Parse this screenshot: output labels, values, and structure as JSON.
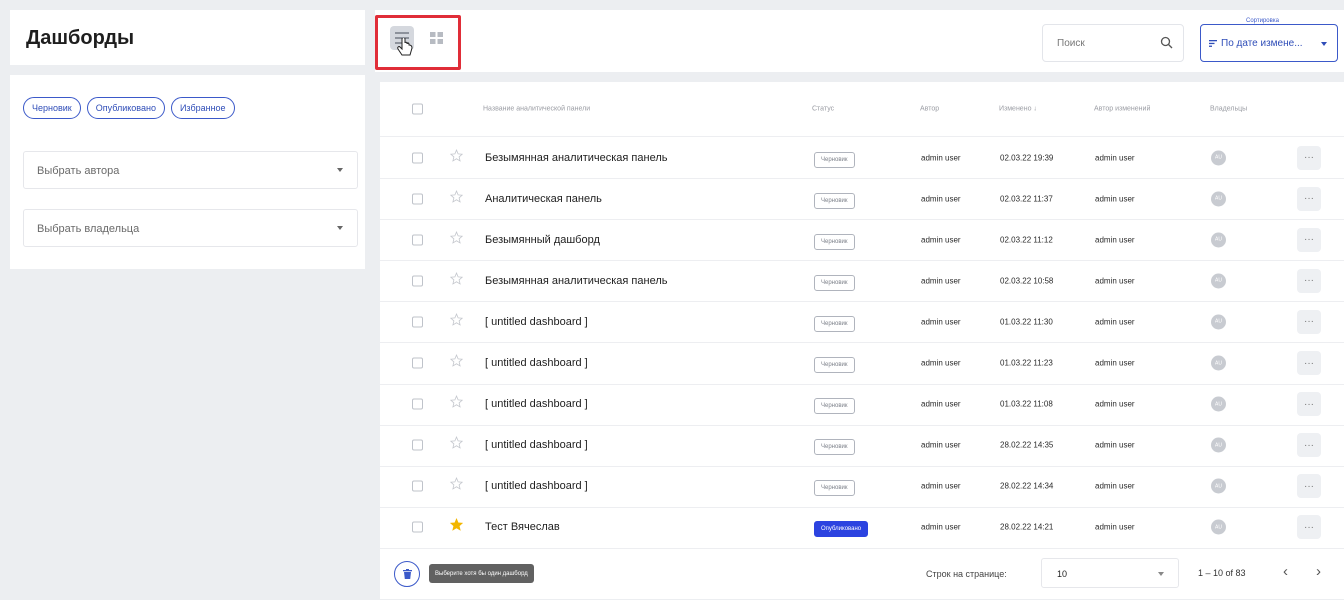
{
  "page": {
    "title": "Дашборды"
  },
  "filters": {
    "chips": [
      "Черновик",
      "Опубликовано",
      "Избранное"
    ],
    "author_select": "Выбрать автора",
    "owner_select": "Выбрать владельца"
  },
  "toolbar": {
    "search_placeholder": "Поиск",
    "sort_legend": "Сортировка",
    "sort_value": "По дате измене..."
  },
  "table": {
    "columns": {
      "name": "Название аналитической панели",
      "status": "Статус",
      "author": "Автор",
      "modified": "Изменено ↓",
      "modified_by": "Автор изменений",
      "owners": "Владельцы"
    },
    "rows": [
      {
        "name": "Безымянная аналитическая панель",
        "status": "Черновик",
        "published": false,
        "favorite": false,
        "author": "admin user",
        "modified": "02.03.22 19:39",
        "modified_by": "admin user",
        "owner": "AU"
      },
      {
        "name": "Аналитическая панель",
        "status": "Черновик",
        "published": false,
        "favorite": false,
        "author": "admin user",
        "modified": "02.03.22 11:37",
        "modified_by": "admin user",
        "owner": "AU"
      },
      {
        "name": "Безымянный дашборд",
        "status": "Черновик",
        "published": false,
        "favorite": false,
        "author": "admin user",
        "modified": "02.03.22 11:12",
        "modified_by": "admin user",
        "owner": "AU"
      },
      {
        "name": "Безымянная аналитическая панель",
        "status": "Черновик",
        "published": false,
        "favorite": false,
        "author": "admin user",
        "modified": "02.03.22 10:58",
        "modified_by": "admin user",
        "owner": "AU"
      },
      {
        "name": "[ untitled dashboard ]",
        "status": "Черновик",
        "published": false,
        "favorite": false,
        "author": "admin user",
        "modified": "01.03.22 11:30",
        "modified_by": "admin user",
        "owner": "AU"
      },
      {
        "name": "[ untitled dashboard ]",
        "status": "Черновик",
        "published": false,
        "favorite": false,
        "author": "admin user",
        "modified": "01.03.22 11:23",
        "modified_by": "admin user",
        "owner": "AU"
      },
      {
        "name": "[ untitled dashboard ]",
        "status": "Черновик",
        "published": false,
        "favorite": false,
        "author": "admin user",
        "modified": "01.03.22 11:08",
        "modified_by": "admin user",
        "owner": "AU"
      },
      {
        "name": "[ untitled dashboard ]",
        "status": "Черновик",
        "published": false,
        "favorite": false,
        "author": "admin user",
        "modified": "28.02.22 14:35",
        "modified_by": "admin user",
        "owner": "AU"
      },
      {
        "name": "[ untitled dashboard ]",
        "status": "Черновик",
        "published": false,
        "favorite": false,
        "author": "admin user",
        "modified": "28.02.22 14:34",
        "modified_by": "admin user",
        "owner": "AU"
      },
      {
        "name": "Тест Вячеслав",
        "status": "Опубликовано",
        "published": true,
        "favorite": true,
        "author": "admin user",
        "modified": "28.02.22 14:21",
        "modified_by": "admin user",
        "owner": "AU"
      }
    ],
    "more_label": "···"
  },
  "footer": {
    "tooltip": "Выберите хотя бы один дашборд",
    "rows_per_page_label": "Строк на странице:",
    "rows_per_page_value": "10",
    "range": "1 – 10 of 83",
    "prev_label": "‹",
    "next_label": "›"
  },
  "colors": {
    "accent": "#3b59c9",
    "published": "#2c43e0",
    "favorite": "#f2b600",
    "highlight": "#e02d38"
  },
  "icons": [
    "list-view-icon",
    "grid-view-icon",
    "pointer-hand-icon",
    "search-icon",
    "sort-icon",
    "star-icon",
    "trash-icon"
  ]
}
